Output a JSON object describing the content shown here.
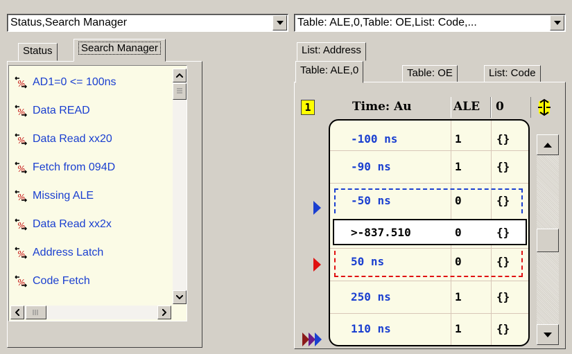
{
  "left_combo": {
    "value": "Status,Search Manager"
  },
  "right_combo": {
    "value": "Table: ALE,0,Table: OE,List: Code,..."
  },
  "left_tabs": [
    {
      "label": "Status"
    },
    {
      "label": "Search Manager"
    }
  ],
  "searches": [
    {
      "label": "AD1=0 <= 100ns"
    },
    {
      "label": "Data READ"
    },
    {
      "label": "Data Read xx20"
    },
    {
      "label": "Fetch from 094D"
    },
    {
      "label": "Missing ALE"
    },
    {
      "label": "Data Read xx2x"
    },
    {
      "label": "Address Latch"
    },
    {
      "label": "Code Fetch"
    }
  ],
  "right_tabs_row1": [
    {
      "label": "List: Address"
    }
  ],
  "right_tabs_row2": [
    {
      "label": "Table: ALE,0"
    },
    {
      "label": "Table: OE"
    },
    {
      "label": "List: Code"
    }
  ],
  "table": {
    "marker_label": "1",
    "header_time": "Time: Au",
    "header_ale": "ALE",
    "header_col": "0",
    "rows": [
      {
        "time": "-100 ns",
        "ale": "1",
        "val": "{}"
      },
      {
        "time": "-90 ns",
        "ale": "1",
        "val": "{}"
      },
      {
        "time": "-50 ns",
        "ale": "0",
        "val": "{}"
      },
      {
        "time": ">-837.510",
        "ale": "0",
        "val": "{}"
      },
      {
        "time": "50 ns",
        "ale": "0",
        "val": "{}"
      },
      {
        "time": "250 ns",
        "ale": "1",
        "val": "{}"
      },
      {
        "time": "110 ns",
        "ale": "1",
        "val": "{}"
      }
    ]
  },
  "colors": {
    "time_text": "#1a3fd0",
    "list_text": "#1a3fd0",
    "list_bg": "#fbfbe6",
    "blue_marker": "#1a3fd0",
    "red_marker": "#e01010",
    "marker_label_bg": "#ffff00"
  }
}
